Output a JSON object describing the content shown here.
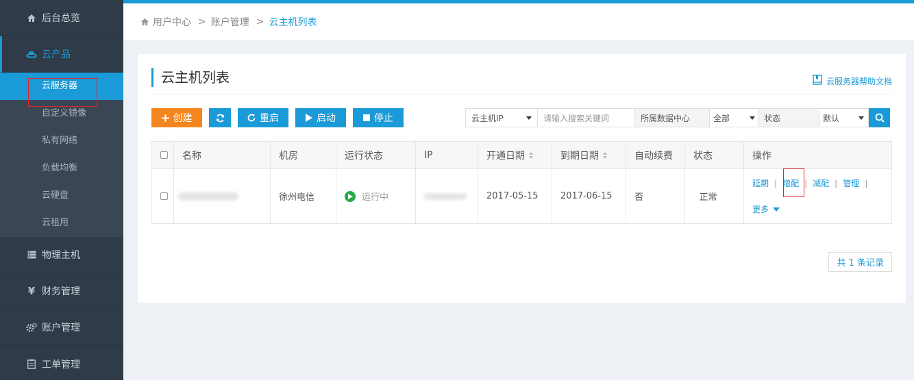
{
  "sidebar": {
    "items": [
      {
        "label": "后台总览",
        "icon": "home-icon"
      },
      {
        "label": "云产品",
        "icon": "cloud-icon"
      },
      {
        "label": "物理主机",
        "icon": "server-icon"
      },
      {
        "label": "财务管理",
        "icon": "yen-icon"
      },
      {
        "label": "账户管理",
        "icon": "gears-icon"
      },
      {
        "label": "工单管理",
        "icon": "clipboard-icon"
      }
    ],
    "subitems": [
      "云服务器",
      "自定义镜像",
      "私有网络",
      "负载均衡",
      "云硬盘",
      "云租用"
    ]
  },
  "breadcrumb": {
    "home": "用户中心",
    "level2": "账户管理",
    "current": "云主机列表",
    "sep": ">"
  },
  "panel": {
    "title": "云主机列表",
    "help": "云服务器帮助文档"
  },
  "toolbar": {
    "create": "创建",
    "restart": "重启",
    "start": "启动",
    "stop": "停止"
  },
  "filters": {
    "type_select": "云主机IP",
    "search_placeholder": "请输入搜索关键词",
    "dc_label": "所属数据中心",
    "dc_select": "全部",
    "status_label": "状态",
    "status_select": "默认"
  },
  "table": {
    "headers": [
      "名称",
      "机房",
      "运行状态",
      "IP",
      "开通日期",
      "到期日期",
      "自动续费",
      "状态",
      "操作"
    ],
    "row": {
      "room": "徐州电信",
      "run_state": "运行中",
      "open_date": "2017-05-15",
      "expire_date": "2017-06-15",
      "auto_renew": "否",
      "status": "正常",
      "ops": [
        "延期",
        "增配",
        "减配",
        "管理"
      ],
      "ops_sep": "|",
      "more": "更多"
    }
  },
  "pager": {
    "total": "共 1 条记录"
  },
  "colors": {
    "accent": "#1a9ad6",
    "orange": "#f5861f",
    "sidebar": "#2f3b48",
    "highlight_box": "#d9282f"
  }
}
